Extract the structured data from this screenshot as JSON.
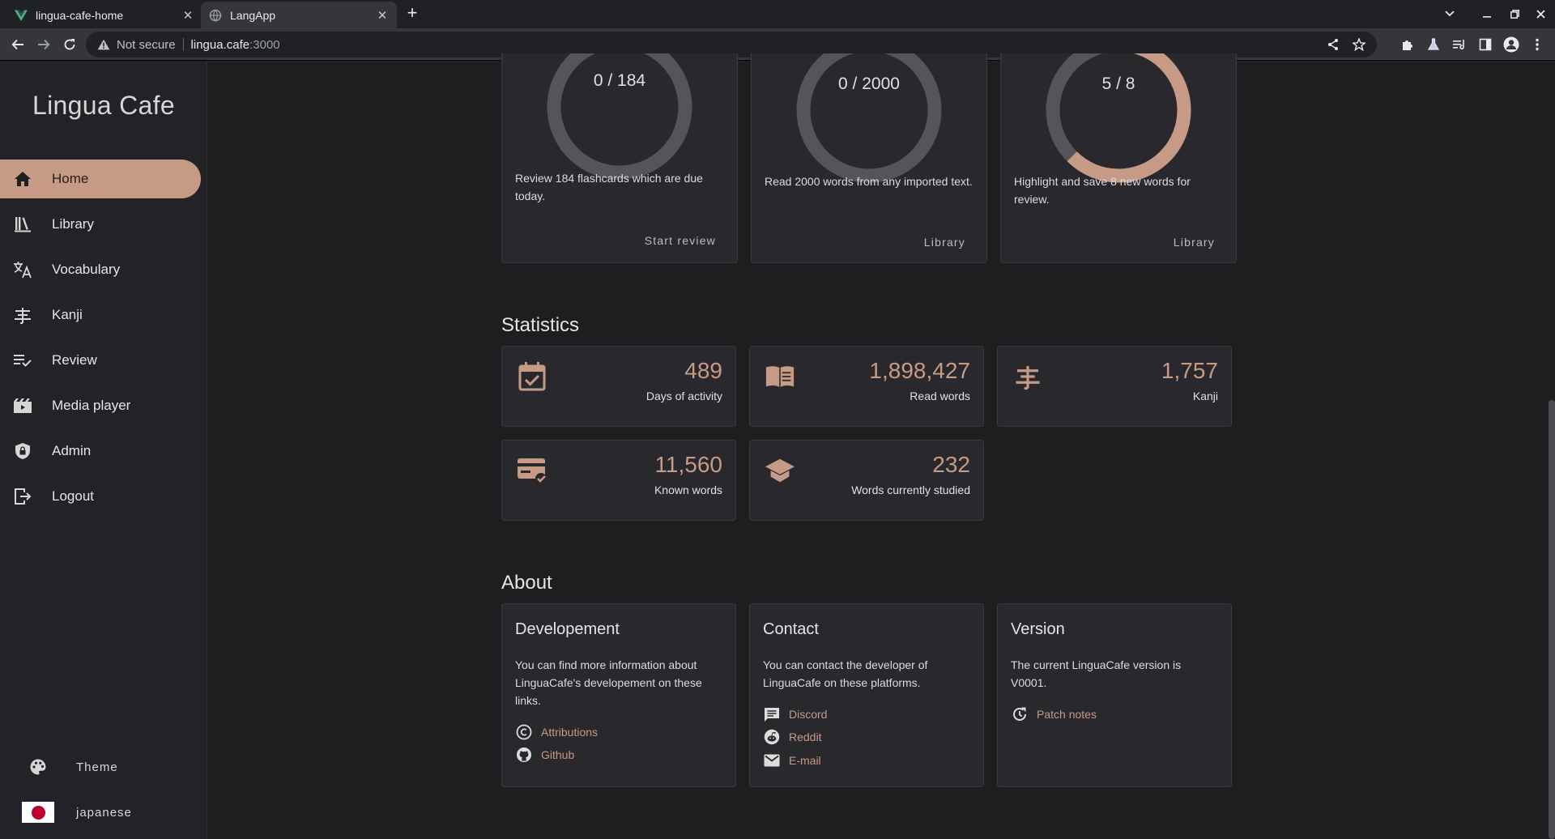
{
  "browser": {
    "tabs": [
      {
        "title": "lingua-cafe-home",
        "active": false
      },
      {
        "title": "LangApp",
        "active": true
      }
    ],
    "address": {
      "security": "Not secure",
      "host": "lingua.cafe",
      "port": ":3000"
    }
  },
  "sidebar": {
    "brand": "Lingua Cafe",
    "items": [
      {
        "label": "Home",
        "icon": "home-icon",
        "active": true
      },
      {
        "label": "Library",
        "icon": "library-icon"
      },
      {
        "label": "Vocabulary",
        "icon": "translate-icon"
      },
      {
        "label": "Kanji",
        "icon": "kanji-icon"
      },
      {
        "label": "Review",
        "icon": "playlist-check-icon"
      },
      {
        "label": "Media player",
        "icon": "movie-icon"
      },
      {
        "label": "Admin",
        "icon": "shield-lock-icon"
      },
      {
        "label": "Logout",
        "icon": "logout-icon"
      }
    ],
    "theme_label": "Theme",
    "language_label": "japanese"
  },
  "goals": [
    {
      "progress_text": "0 / 184",
      "progress": 0,
      "description": "Review 184 flashcards which are due today.",
      "action": "Start review"
    },
    {
      "progress_text": "0 / 2000",
      "progress": 0,
      "description": "Read 2000 words from any imported text.",
      "action": "Library"
    },
    {
      "progress_text": "5 / 8",
      "progress": 0.625,
      "description": "Highlight and save 8 new words for review.",
      "action": "Library"
    }
  ],
  "statistics": {
    "title": "Statistics",
    "items": [
      {
        "value": "489",
        "label": "Days of activity",
        "icon": "calendar-check-icon"
      },
      {
        "value": "1,898,427",
        "label": "Read words",
        "icon": "book-open-icon"
      },
      {
        "value": "1,757",
        "label": "Kanji",
        "icon": "kanji-icon"
      },
      {
        "value": "11,560",
        "label": "Known words",
        "icon": "card-check-icon"
      },
      {
        "value": "232",
        "label": "Words currently studied",
        "icon": "school-icon"
      }
    ]
  },
  "about": {
    "title": "About",
    "development": {
      "title": "Developement",
      "text": "You can find more information about LinguaCafe's developement on these links.",
      "links": [
        "Attributions",
        "Github"
      ]
    },
    "contact": {
      "title": "Contact",
      "text": "You can contact the developer of LinguaCafe on these platforms.",
      "links": [
        "Discord",
        "Reddit",
        "E-mail"
      ]
    },
    "version": {
      "title": "Version",
      "text": "The current LinguaCafe version is V0001.",
      "links": [
        "Patch notes"
      ]
    }
  },
  "colors": {
    "accent": "#c79a85",
    "background": "#1e1e21",
    "card": "#28282d",
    "sidebar": "#232327"
  }
}
